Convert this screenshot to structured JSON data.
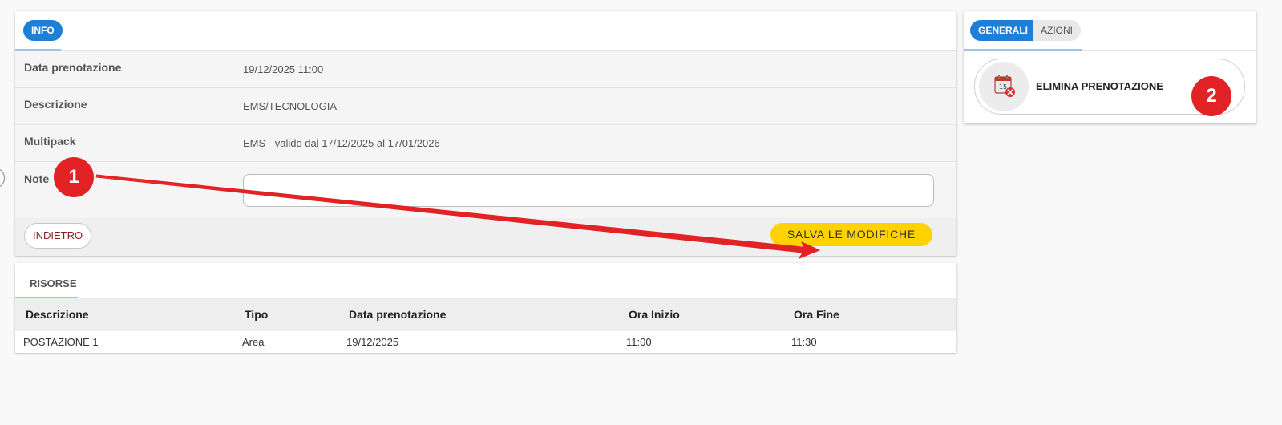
{
  "info": {
    "tab_label": "INFO",
    "rows": [
      {
        "label": "Data prenotazione",
        "value": "19/12/2025 11:00"
      },
      {
        "label": "Descrizione",
        "value": "EMS/TECNOLOGIA"
      },
      {
        "label": "Multipack",
        "value": "EMS - valido dal 17/12/2025 al 17/01/2026"
      }
    ],
    "note_label": "Note",
    "note_value": "",
    "back_label": "INDIETRO",
    "save_label": "SALVA LE MODIFICHE"
  },
  "risorse": {
    "title": "RISORSE",
    "columns": [
      "Descrizione",
      "Tipo",
      "Data prenotazione",
      "Ora Inizio",
      "Ora Fine"
    ],
    "rows": [
      [
        "POSTAZIONE 1",
        "Area",
        "19/12/2025",
        "11:00",
        "11:30"
      ]
    ]
  },
  "side": {
    "tabs": [
      "GENERALI",
      "AZIONI"
    ],
    "action_label": "ELIMINA PRENOTAZIONE",
    "action_icon": "calendar-delete-icon"
  },
  "annotations": {
    "badge1": "1",
    "badge2": "2",
    "color": "#e32226"
  },
  "colors": {
    "accent": "#1e7fd9",
    "save_button": "#ffd200",
    "back_text": "#8b1f1f"
  }
}
